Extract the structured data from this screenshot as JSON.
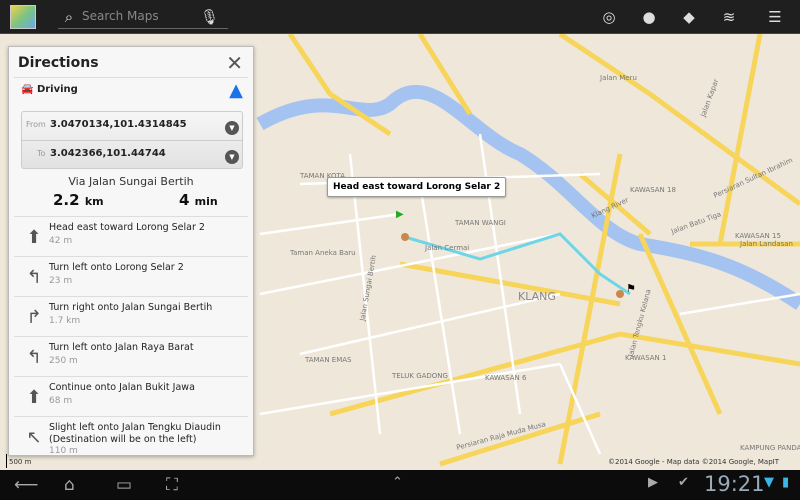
{
  "topbar": {
    "search_placeholder": "Search Maps"
  },
  "panel": {
    "title": "Directions",
    "mode": "Driving",
    "from_label": "From",
    "from_value": "3.0470134,101.4314845",
    "to_label": "To",
    "to_value": "3.042366,101.44744",
    "via": "Via Jalan Sungai Bertih",
    "distance_value": "2.2",
    "distance_unit": "km",
    "time_value": "4",
    "time_unit": "min",
    "steps": [
      {
        "icon": "straight-icon",
        "text": "Head east toward Lorong Selar 2",
        "dist": "42 m"
      },
      {
        "icon": "turn-left-icon",
        "text": "Turn left onto Lorong Selar 2",
        "dist": "23 m"
      },
      {
        "icon": "turn-right-icon",
        "text": "Turn right onto Jalan Sungai Bertih",
        "dist": "1.7 km"
      },
      {
        "icon": "turn-left-icon",
        "text": "Turn left onto Jalan Raya Barat",
        "dist": "250 m"
      },
      {
        "icon": "straight-icon",
        "text": "Continue onto Jalan Bukit Jawa",
        "dist": "68 m"
      },
      {
        "icon": "slight-left-icon",
        "text": "Slight left onto Jalan Tengku Diaudin (Destination will be on the left)",
        "dist": "110 m"
      }
    ]
  },
  "map": {
    "bubble": "Head east toward Lorong Selar 2",
    "copyright": "©2014 Google - Map data ©2014 Google, MapIT",
    "scale": "500 m",
    "labels": {
      "klang": "KLANG",
      "river": "Klang River",
      "kawasan18": "KAWASAN 18",
      "kawasan1": "KAWASAN 1",
      "kawasan6": "KAWASAN 6",
      "kawasan15": "KAWASAN 15",
      "sungai": "Jalan Sungai Bertih",
      "kota": "TAMAN KOTA",
      "cermai": "Jalan Cermai",
      "emas": "TAMAN EMAS",
      "gadong": "TELUK GADONG",
      "kapar": "Jalan Kapar",
      "meru": "Jalan Meru",
      "musa": "Persiaran Raja Muda Musa",
      "tengku": "Jalan Tengku Kelana",
      "landasan": "Jalan Landasan",
      "pandan": "Taman Aneka Baru",
      "wangi": "TAMAN WANGI",
      "batu": "Jalan Batu Tiga",
      "sultan": "Persiaran Sultan Ibrahim",
      "kampung": "KAMPUNG PANDAN"
    }
  },
  "statusbar": {
    "time": "19:21"
  }
}
